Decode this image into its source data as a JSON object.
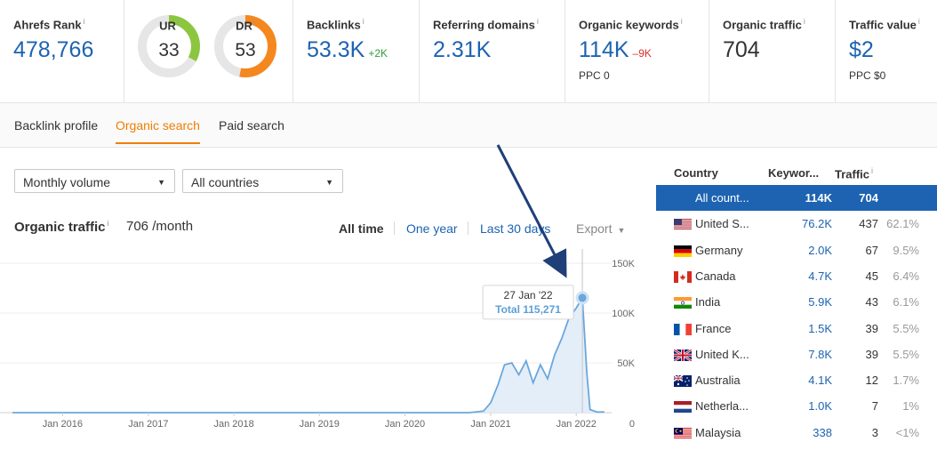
{
  "metrics": {
    "ahrefs_rank": {
      "label": "Ahrefs Rank",
      "info": "i",
      "value": "478,766"
    },
    "ur": {
      "label": "UR",
      "info": "i",
      "value": "33",
      "score": 33,
      "color": "#8cc63f"
    },
    "dr": {
      "label": "DR",
      "info": "i",
      "value": "53",
      "score": 53,
      "color": "#f5871f"
    },
    "backlinks": {
      "label": "Backlinks",
      "info": "i",
      "value": "53.3K",
      "delta": "+2K"
    },
    "referring_domains": {
      "label": "Referring domains",
      "info": "i",
      "value": "2.31K"
    },
    "organic_keywords": {
      "label": "Organic keywords",
      "info": "i",
      "value": "114K",
      "delta": "–9K",
      "sub": "PPC 0"
    },
    "organic_traffic": {
      "label": "Organic traffic",
      "info": "i",
      "value": "704"
    },
    "traffic_value": {
      "label": "Traffic value",
      "info": "i",
      "value": "$2",
      "sub": "PPC $0"
    }
  },
  "tabs": [
    {
      "label": "Backlink profile",
      "active": false
    },
    {
      "label": "Organic search",
      "active": true
    },
    {
      "label": "Paid search",
      "active": false
    }
  ],
  "filters": {
    "volume": "Monthly volume",
    "countries": "All countries"
  },
  "traffic": {
    "title": "Organic traffic",
    "info": "i",
    "value": "706 /month",
    "ranges": [
      "All time",
      "One year",
      "Last 30 days"
    ],
    "active_range": "All time",
    "export_label": "Export"
  },
  "chart_data": {
    "type": "area",
    "x_ticks": [
      "Jan 2016",
      "Jan 2017",
      "Jan 2018",
      "Jan 2019",
      "Jan 2020",
      "Jan 2021",
      "Jan 2022"
    ],
    "y_ticks": [
      "150K",
      "100K",
      "50K",
      "0"
    ],
    "ylim": [
      0,
      150000
    ],
    "xlim": [
      "2015-06-01",
      "2022-06-01"
    ],
    "series": [
      {
        "points": [
          [
            "2015-06-01",
            0
          ],
          [
            "2020-10-01",
            0
          ],
          [
            "2020-12-01",
            1500
          ],
          [
            "2021-01-01",
            10000
          ],
          [
            "2021-02-01",
            28000
          ],
          [
            "2021-03-01",
            48000
          ],
          [
            "2021-04-01",
            50000
          ],
          [
            "2021-05-01",
            38000
          ],
          [
            "2021-06-01",
            52000
          ],
          [
            "2021-07-01",
            30000
          ],
          [
            "2021-08-01",
            48000
          ],
          [
            "2021-09-01",
            34000
          ],
          [
            "2021-10-01",
            58000
          ],
          [
            "2021-11-01",
            75000
          ],
          [
            "2021-12-01",
            95000
          ],
          [
            "2022-01-01",
            105000
          ],
          [
            "2022-01-27",
            115271
          ],
          [
            "2022-02-15",
            40000
          ],
          [
            "2022-03-01",
            3000
          ],
          [
            "2022-04-01",
            500
          ],
          [
            "2022-05-01",
            700
          ]
        ],
        "color": "#6aa7dc"
      }
    ],
    "tooltip": {
      "date": "27 Jan '22",
      "label": "Total 115,271",
      "x": "2022-01-27",
      "y": 115271
    },
    "annotation": "arrow pointing to peak",
    "grid": true
  },
  "country_table": {
    "headers": {
      "country": "Country",
      "keywords": "Keywor...",
      "traffic": "Traffic",
      "traffic_info": "i"
    },
    "rows": [
      {
        "flag": "all",
        "name": "All count...",
        "keywords": "114K",
        "traffic": "704",
        "pct": "",
        "selected": true
      },
      {
        "flag": "us",
        "name": "United S...",
        "keywords": "76.2K",
        "traffic": "437",
        "pct": "62.1%"
      },
      {
        "flag": "de",
        "name": "Germany",
        "keywords": "2.0K",
        "traffic": "67",
        "pct": "9.5%"
      },
      {
        "flag": "ca",
        "name": "Canada",
        "keywords": "4.7K",
        "traffic": "45",
        "pct": "6.4%"
      },
      {
        "flag": "in",
        "name": "India",
        "keywords": "5.9K",
        "traffic": "43",
        "pct": "6.1%"
      },
      {
        "flag": "fr",
        "name": "France",
        "keywords": "1.5K",
        "traffic": "39",
        "pct": "5.5%"
      },
      {
        "flag": "gb",
        "name": "United K...",
        "keywords": "7.8K",
        "traffic": "39",
        "pct": "5.5%"
      },
      {
        "flag": "au",
        "name": "Australia",
        "keywords": "4.1K",
        "traffic": "12",
        "pct": "1.7%"
      },
      {
        "flag": "nl",
        "name": "Netherla...",
        "keywords": "1.0K",
        "traffic": "7",
        "pct": "1%"
      },
      {
        "flag": "my",
        "name": "Malaysia",
        "keywords": "338",
        "traffic": "3",
        "pct": "<1%"
      }
    ]
  }
}
